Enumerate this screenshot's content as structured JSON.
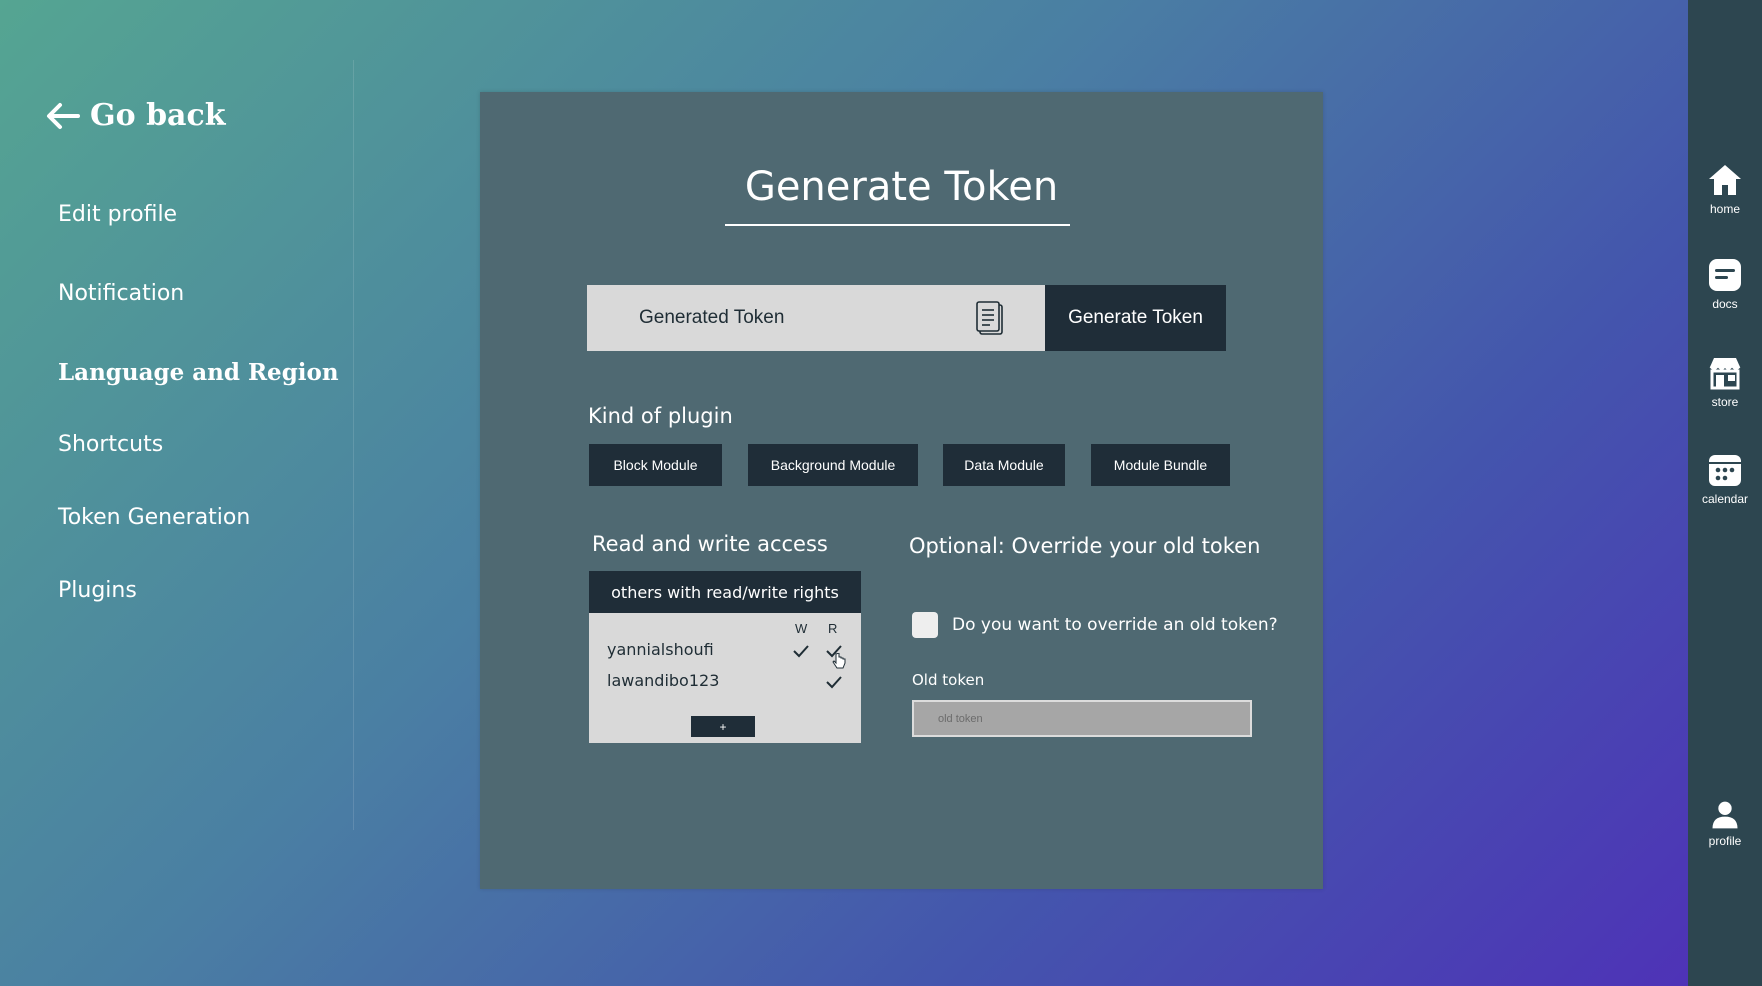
{
  "nav": {
    "go_back": "Go back",
    "items": [
      {
        "label": "Edit profile",
        "active": false
      },
      {
        "label": "Notification",
        "active": false
      },
      {
        "label": "Language and Region",
        "active": true
      },
      {
        "label": "Shortcuts",
        "active": false
      },
      {
        "label": "Token Generation",
        "active": false
      },
      {
        "label": "Plugins",
        "active": false
      }
    ]
  },
  "rail": {
    "items": [
      {
        "label": "home",
        "icon": "home-icon"
      },
      {
        "label": "docs",
        "icon": "docs-icon"
      },
      {
        "label": "store",
        "icon": "store-icon"
      },
      {
        "label": "calendar",
        "icon": "calendar-icon"
      },
      {
        "label": "profile",
        "icon": "profile-icon"
      }
    ]
  },
  "main": {
    "title": "Generate Token",
    "token_field": "Generated Token",
    "generate_button": "Generate Token",
    "plugin_section_label": "Kind of plugin",
    "plugin_kinds": [
      "Block Module",
      "Background Module",
      "Data Module",
      "Module Bundle"
    ],
    "access": {
      "label": "Read and write access",
      "header": "others with read/write rights",
      "col_write": "W",
      "col_read": "R",
      "users": [
        {
          "name": "yannialshoufi",
          "write": true,
          "read": true
        },
        {
          "name": "lawandibo123",
          "write": false,
          "read": true
        }
      ],
      "add_label": "+"
    },
    "override": {
      "label": "Optional: Override your old token",
      "checkbox_label": "Do you want to override an old token?",
      "checked": false,
      "old_token_label": "Old token",
      "old_token_placeholder": "old token"
    }
  },
  "colors": {
    "card_bg": "#4f6972",
    "dark_button": "#1f2d38",
    "rail_bg": "#2d4650",
    "light_field": "#d9d9d9"
  }
}
